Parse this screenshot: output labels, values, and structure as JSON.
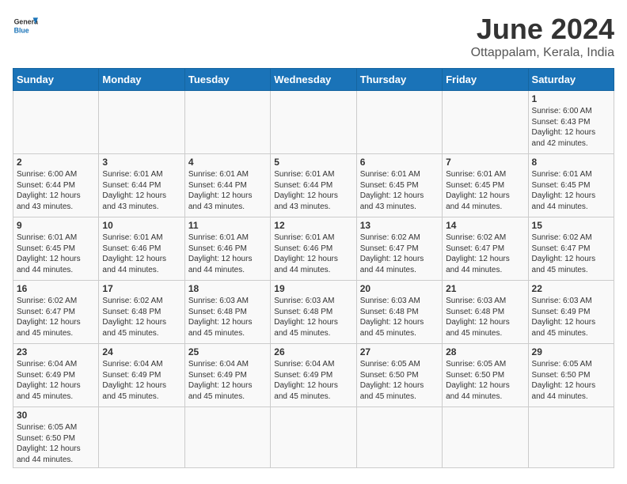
{
  "header": {
    "logo_general": "General",
    "logo_blue": "Blue",
    "month_title": "June 2024",
    "subtitle": "Ottappalam, Kerala, India"
  },
  "weekdays": [
    "Sunday",
    "Monday",
    "Tuesday",
    "Wednesday",
    "Thursday",
    "Friday",
    "Saturday"
  ],
  "weeks": [
    [
      {
        "day": "",
        "info": ""
      },
      {
        "day": "",
        "info": ""
      },
      {
        "day": "",
        "info": ""
      },
      {
        "day": "",
        "info": ""
      },
      {
        "day": "",
        "info": ""
      },
      {
        "day": "",
        "info": ""
      },
      {
        "day": "1",
        "info": "Sunrise: 6:00 AM\nSunset: 6:43 PM\nDaylight: 12 hours\nand 42 minutes."
      }
    ],
    [
      {
        "day": "2",
        "info": "Sunrise: 6:00 AM\nSunset: 6:44 PM\nDaylight: 12 hours\nand 43 minutes."
      },
      {
        "day": "3",
        "info": "Sunrise: 6:01 AM\nSunset: 6:44 PM\nDaylight: 12 hours\nand 43 minutes."
      },
      {
        "day": "4",
        "info": "Sunrise: 6:01 AM\nSunset: 6:44 PM\nDaylight: 12 hours\nand 43 minutes."
      },
      {
        "day": "5",
        "info": "Sunrise: 6:01 AM\nSunset: 6:44 PM\nDaylight: 12 hours\nand 43 minutes."
      },
      {
        "day": "6",
        "info": "Sunrise: 6:01 AM\nSunset: 6:45 PM\nDaylight: 12 hours\nand 43 minutes."
      },
      {
        "day": "7",
        "info": "Sunrise: 6:01 AM\nSunset: 6:45 PM\nDaylight: 12 hours\nand 44 minutes."
      },
      {
        "day": "8",
        "info": "Sunrise: 6:01 AM\nSunset: 6:45 PM\nDaylight: 12 hours\nand 44 minutes."
      }
    ],
    [
      {
        "day": "9",
        "info": "Sunrise: 6:01 AM\nSunset: 6:45 PM\nDaylight: 12 hours\nand 44 minutes."
      },
      {
        "day": "10",
        "info": "Sunrise: 6:01 AM\nSunset: 6:46 PM\nDaylight: 12 hours\nand 44 minutes."
      },
      {
        "day": "11",
        "info": "Sunrise: 6:01 AM\nSunset: 6:46 PM\nDaylight: 12 hours\nand 44 minutes."
      },
      {
        "day": "12",
        "info": "Sunrise: 6:01 AM\nSunset: 6:46 PM\nDaylight: 12 hours\nand 44 minutes."
      },
      {
        "day": "13",
        "info": "Sunrise: 6:02 AM\nSunset: 6:47 PM\nDaylight: 12 hours\nand 44 minutes."
      },
      {
        "day": "14",
        "info": "Sunrise: 6:02 AM\nSunset: 6:47 PM\nDaylight: 12 hours\nand 44 minutes."
      },
      {
        "day": "15",
        "info": "Sunrise: 6:02 AM\nSunset: 6:47 PM\nDaylight: 12 hours\nand 45 minutes."
      }
    ],
    [
      {
        "day": "16",
        "info": "Sunrise: 6:02 AM\nSunset: 6:47 PM\nDaylight: 12 hours\nand 45 minutes."
      },
      {
        "day": "17",
        "info": "Sunrise: 6:02 AM\nSunset: 6:48 PM\nDaylight: 12 hours\nand 45 minutes."
      },
      {
        "day": "18",
        "info": "Sunrise: 6:03 AM\nSunset: 6:48 PM\nDaylight: 12 hours\nand 45 minutes."
      },
      {
        "day": "19",
        "info": "Sunrise: 6:03 AM\nSunset: 6:48 PM\nDaylight: 12 hours\nand 45 minutes."
      },
      {
        "day": "20",
        "info": "Sunrise: 6:03 AM\nSunset: 6:48 PM\nDaylight: 12 hours\nand 45 minutes."
      },
      {
        "day": "21",
        "info": "Sunrise: 6:03 AM\nSunset: 6:48 PM\nDaylight: 12 hours\nand 45 minutes."
      },
      {
        "day": "22",
        "info": "Sunrise: 6:03 AM\nSunset: 6:49 PM\nDaylight: 12 hours\nand 45 minutes."
      }
    ],
    [
      {
        "day": "23",
        "info": "Sunrise: 6:04 AM\nSunset: 6:49 PM\nDaylight: 12 hours\nand 45 minutes."
      },
      {
        "day": "24",
        "info": "Sunrise: 6:04 AM\nSunset: 6:49 PM\nDaylight: 12 hours\nand 45 minutes."
      },
      {
        "day": "25",
        "info": "Sunrise: 6:04 AM\nSunset: 6:49 PM\nDaylight: 12 hours\nand 45 minutes."
      },
      {
        "day": "26",
        "info": "Sunrise: 6:04 AM\nSunset: 6:49 PM\nDaylight: 12 hours\nand 45 minutes."
      },
      {
        "day": "27",
        "info": "Sunrise: 6:05 AM\nSunset: 6:50 PM\nDaylight: 12 hours\nand 45 minutes."
      },
      {
        "day": "28",
        "info": "Sunrise: 6:05 AM\nSunset: 6:50 PM\nDaylight: 12 hours\nand 44 minutes."
      },
      {
        "day": "29",
        "info": "Sunrise: 6:05 AM\nSunset: 6:50 PM\nDaylight: 12 hours\nand 44 minutes."
      }
    ],
    [
      {
        "day": "30",
        "info": "Sunrise: 6:05 AM\nSunset: 6:50 PM\nDaylight: 12 hours\nand 44 minutes."
      },
      {
        "day": "",
        "info": ""
      },
      {
        "day": "",
        "info": ""
      },
      {
        "day": "",
        "info": ""
      },
      {
        "day": "",
        "info": ""
      },
      {
        "day": "",
        "info": ""
      },
      {
        "day": "",
        "info": ""
      }
    ]
  ]
}
